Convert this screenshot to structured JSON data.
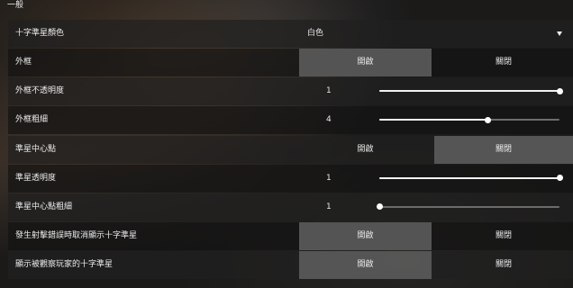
{
  "section_title": "一般",
  "rows": [
    {
      "label": "十字準星顏色",
      "type": "dropdown",
      "value": "白色"
    },
    {
      "label": "外框",
      "type": "toggle",
      "on_label": "開啟",
      "off_label": "關閉",
      "selected": "on"
    },
    {
      "label": "外框不透明度",
      "type": "slider",
      "value": "1",
      "fraction": 1.0
    },
    {
      "label": "外框粗細",
      "type": "slider",
      "value": "4",
      "fraction": 0.6
    },
    {
      "label": "準星中心點",
      "type": "toggle",
      "on_label": "開啟",
      "off_label": "關閉",
      "selected": "off"
    },
    {
      "label": "準星透明度",
      "type": "slider",
      "value": "1",
      "fraction": 1.0
    },
    {
      "label": "準星中心點粗細",
      "type": "slider",
      "value": "1",
      "fraction": 0.0
    },
    {
      "label": "發生射擊錯誤時取消顯示十字準星",
      "type": "toggle",
      "on_label": "開啟",
      "off_label": "關閉",
      "selected": "on"
    },
    {
      "label": "顯示被觀察玩家的十字準星",
      "type": "toggle",
      "on_label": "開啟",
      "off_label": "關閉",
      "selected": "on"
    }
  ],
  "colors": {
    "selected_button": "#5f5f5f",
    "track_fill": "#f2f2f2",
    "track_empty": "#6c6c6c"
  }
}
